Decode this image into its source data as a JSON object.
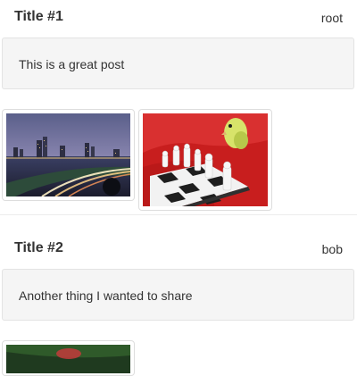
{
  "posts": [
    {
      "title": "Title #1",
      "author": "root",
      "body": "This is a great post",
      "images": [
        "city-night-photo",
        "chess-parakeet-photo"
      ]
    },
    {
      "title": "Title #2",
      "author": "bob",
      "body": "Another thing I wanted to share",
      "images": [
        "dark-partial-photo"
      ]
    }
  ],
  "colors": {
    "panel_bg": "#f5f5f5",
    "panel_border": "#e3e3e3",
    "text": "#333333"
  }
}
